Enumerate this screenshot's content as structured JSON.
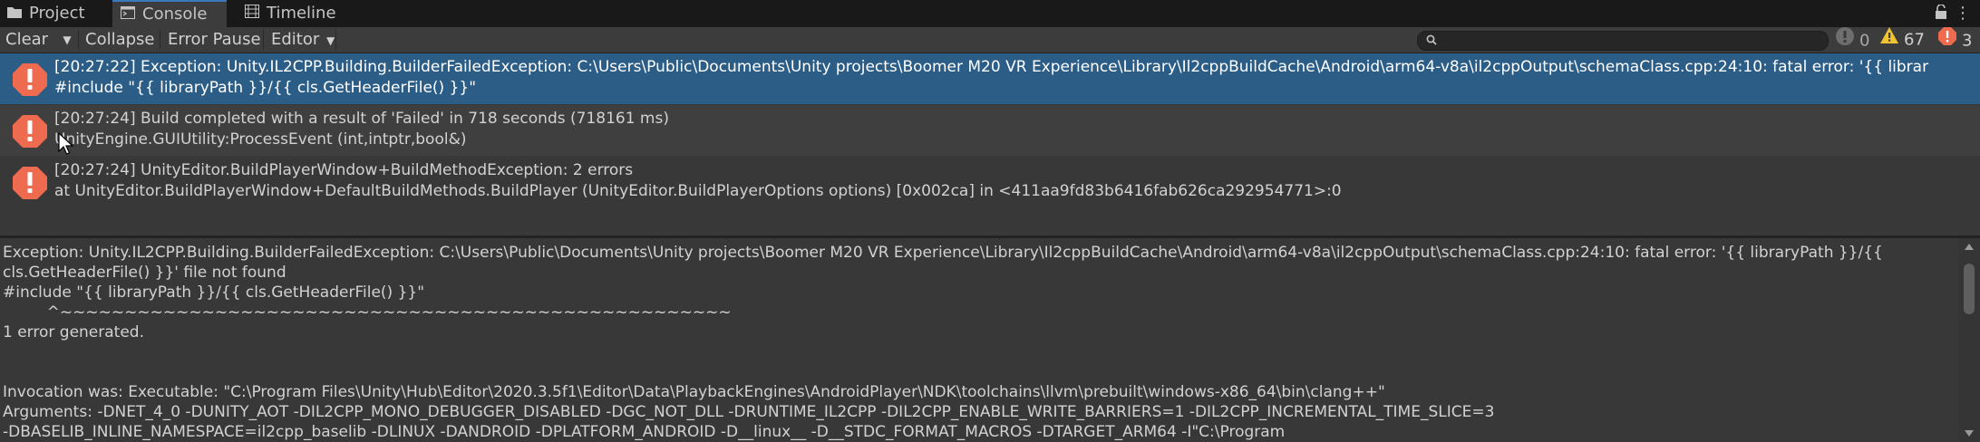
{
  "tabs": [
    {
      "label": "Project",
      "icon": "folder-icon"
    },
    {
      "label": "Console",
      "icon": "console-icon"
    },
    {
      "label": "Timeline",
      "icon": "timeline-icon"
    }
  ],
  "toolbar": {
    "clear_label": "Clear",
    "collapse_label": "Collapse",
    "error_pause_label": "Error Pause",
    "editor_label": "Editor",
    "search_placeholder": "",
    "counts": {
      "info": "0",
      "warnings": "67",
      "errors": "3"
    }
  },
  "logs": [
    {
      "line1": "[20:27:22] Exception: Unity.IL2CPP.Building.BuilderFailedException: C:\\Users\\Public\\Documents\\Unity projects\\Boomer M20 VR Experience\\Library\\Il2cppBuildCache\\Android\\arm64-v8a\\il2cppOutput\\schemaClass.cpp:24:10: fatal error: '{{ librar",
      "line2": "#include \"{{ libraryPath }}/{{ cls.GetHeaderFile() }}\"",
      "selected": true
    },
    {
      "line1": "[20:27:24] Build completed with a result of 'Failed' in 718 seconds (718161 ms)",
      "line2": "UnityEngine.GUIUtility:ProcessEvent (int,intptr,bool&)",
      "selected": false
    },
    {
      "line1": "[20:27:24] UnityEditor.BuildPlayerWindow+BuildMethodException: 2 errors",
      "line2": " at UnityEditor.BuildPlayerWindow+DefaultBuildMethods.BuildPlayer (UnityEditor.BuildPlayerOptions options) [0x002ca] in <411aa9fd83b6416fab626ca292954771>:0",
      "selected": false
    }
  ],
  "detail": {
    "text": "Exception: Unity.IL2CPP.Building.BuilderFailedException: C:\\Users\\Public\\Documents\\Unity projects\\Boomer M20 VR Experience\\Library\\Il2cppBuildCache\\Android\\arm64-v8a\\il2cppOutput\\schemaClass.cpp:24:10: fatal error: '{{ libraryPath }}/{{ cls.GetHeaderFile() }}' file not found\n#include \"{{ libraryPath }}/{{ cls.GetHeaderFile() }}\"\n         ^~~~~~~~~~~~~~~~~~~~~~~~~~~~~~~~~~~~~~~~~~~~~~~~~~~~~\n1 error generated.\n\n\nInvocation was: Executable: \"C:\\Program Files\\Unity\\Hub\\Editor\\2020.3.5f1\\Editor\\Data\\PlaybackEngines\\AndroidPlayer\\NDK\\toolchains\\llvm\\prebuilt\\windows-x86_64\\bin\\clang++\"\nArguments: -DNET_4_0 -DUNITY_AOT -DIL2CPP_MONO_DEBUGGER_DISABLED -DGC_NOT_DLL -DRUNTIME_IL2CPP -DIL2CPP_ENABLE_WRITE_BARRIERS=1 -DIL2CPP_INCREMENTAL_TIME_SLICE=3\n-DBASELIB_INLINE_NAMESPACE=il2cpp_baselib -DLINUX -DANDROID -DPLATFORM_ANDROID -D__linux__ -D__STDC_FORMAT_MACROS -DTARGET_ARM64 -I\"C:\\Program"
  },
  "colors": {
    "selected_row": "#2c5d87",
    "error_icon": "#ef6b50",
    "warning_icon": "#f1c232"
  }
}
